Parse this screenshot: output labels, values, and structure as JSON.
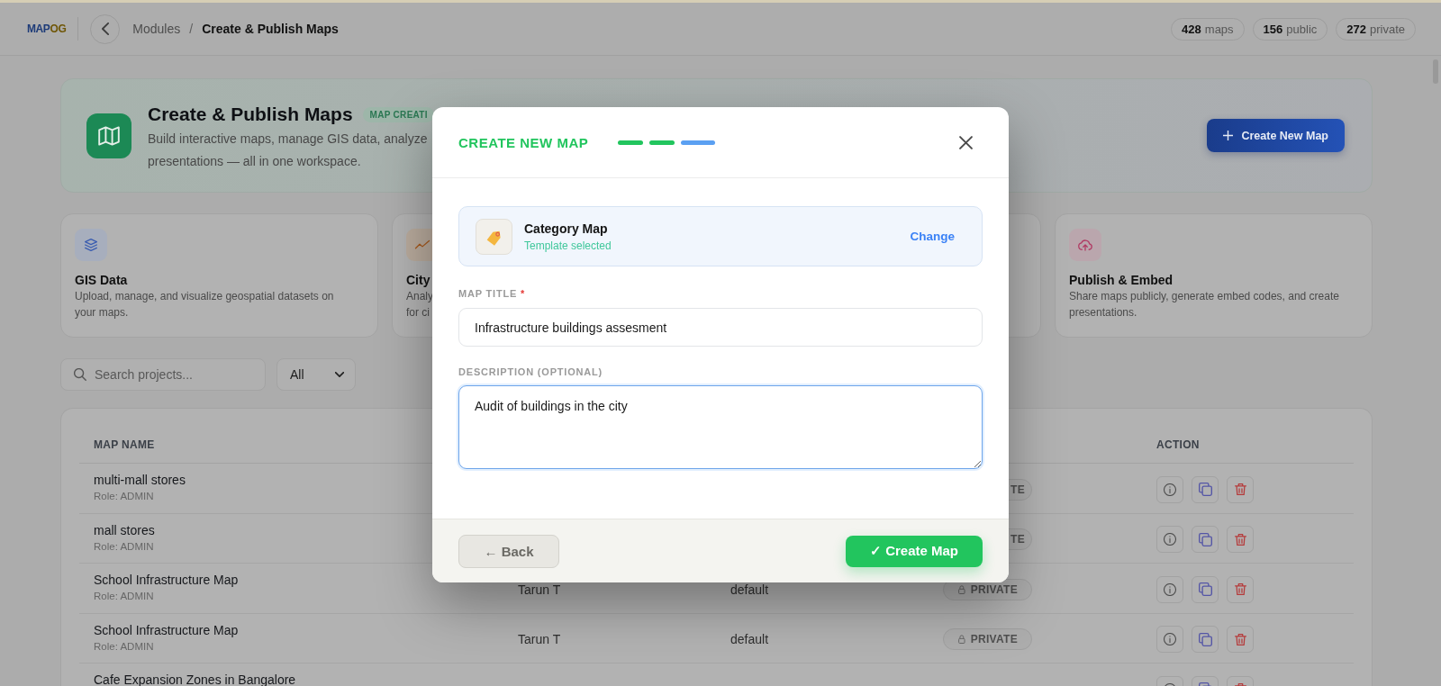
{
  "topbar": {
    "logo": {
      "lead": "MAP",
      "tail": "OG"
    },
    "breadcrumb": [
      {
        "label": "Modules",
        "current": false
      },
      {
        "label": "Create & Publish Maps",
        "current": true
      }
    ],
    "separator": "/",
    "stats": [
      "**428** maps",
      "**156** public",
      "**272** private"
    ]
  },
  "hero": {
    "title": "Create & Publish Maps",
    "badge": "MAP CREATI",
    "description_lines": [
      "Build interactive maps, manage GIS data, analyze",
      "presentations — all in one workspace."
    ],
    "button": "Create New Map"
  },
  "modules": [
    {
      "kind": "data",
      "title": "GIS Data",
      "description_lines": [
        "Upload, manage, and visualize geospatial datasets on",
        "your maps."
      ]
    },
    {
      "kind": "analytics",
      "title": "City",
      "description_lines": [
        "Analy",
        "for ci"
      ]
    },
    {
      "kind": "covered"
    },
    {
      "kind": "publish",
      "title": "Publish & Embed",
      "description_lines": [
        "Share maps publicly, generate embed codes, and create",
        "presentations."
      ]
    }
  ],
  "search": {
    "placeholder": "Search projects..."
  },
  "filter": {
    "value": "All"
  },
  "table": {
    "columns": {
      "name": "MAP NAME",
      "action": "ACTION"
    },
    "rows": [
      {
        "name": "multi-mall stores",
        "role": "Role: ADMIN",
        "status": {
          "text": "TE",
          "clipped": true
        }
      },
      {
        "name": "mall stores",
        "role": "Role: ADMIN",
        "status": {
          "text": "TE",
          "clipped": true
        }
      },
      {
        "name": "School Infrastructure Map",
        "role": "Role: ADMIN",
        "column_2": "Tarun T",
        "column_3": "default",
        "status": {
          "text": "PRIVATE",
          "clipped": false
        }
      },
      {
        "name": "School Infrastructure Map",
        "role": "Role: ADMIN",
        "column_2": "Tarun T",
        "column_3": "default",
        "status": {
          "text": "PRIVATE",
          "clipped": false
        }
      },
      {
        "name": "Cafe Expansion Zones in Bangalore"
      }
    ]
  },
  "modal": {
    "title": "CREATE NEW MAP",
    "steps": [
      {
        "current": false
      },
      {
        "current": false
      },
      {
        "current": true
      }
    ],
    "template": {
      "name": "Category Map",
      "status": "Template selected",
      "action": "Change"
    },
    "fields": [
      {
        "kind": "input",
        "label": "MAP TITLE",
        "required_mark": "*",
        "value": "Infrastructure buildings assesment",
        "focused": false
      },
      {
        "kind": "textarea",
        "label": "DESCRIPTION (OPTIONAL)",
        "value": "Audit of buildings in the city",
        "focused": true
      }
    ],
    "back": "← Back",
    "submit": "✓ Create Map"
  }
}
